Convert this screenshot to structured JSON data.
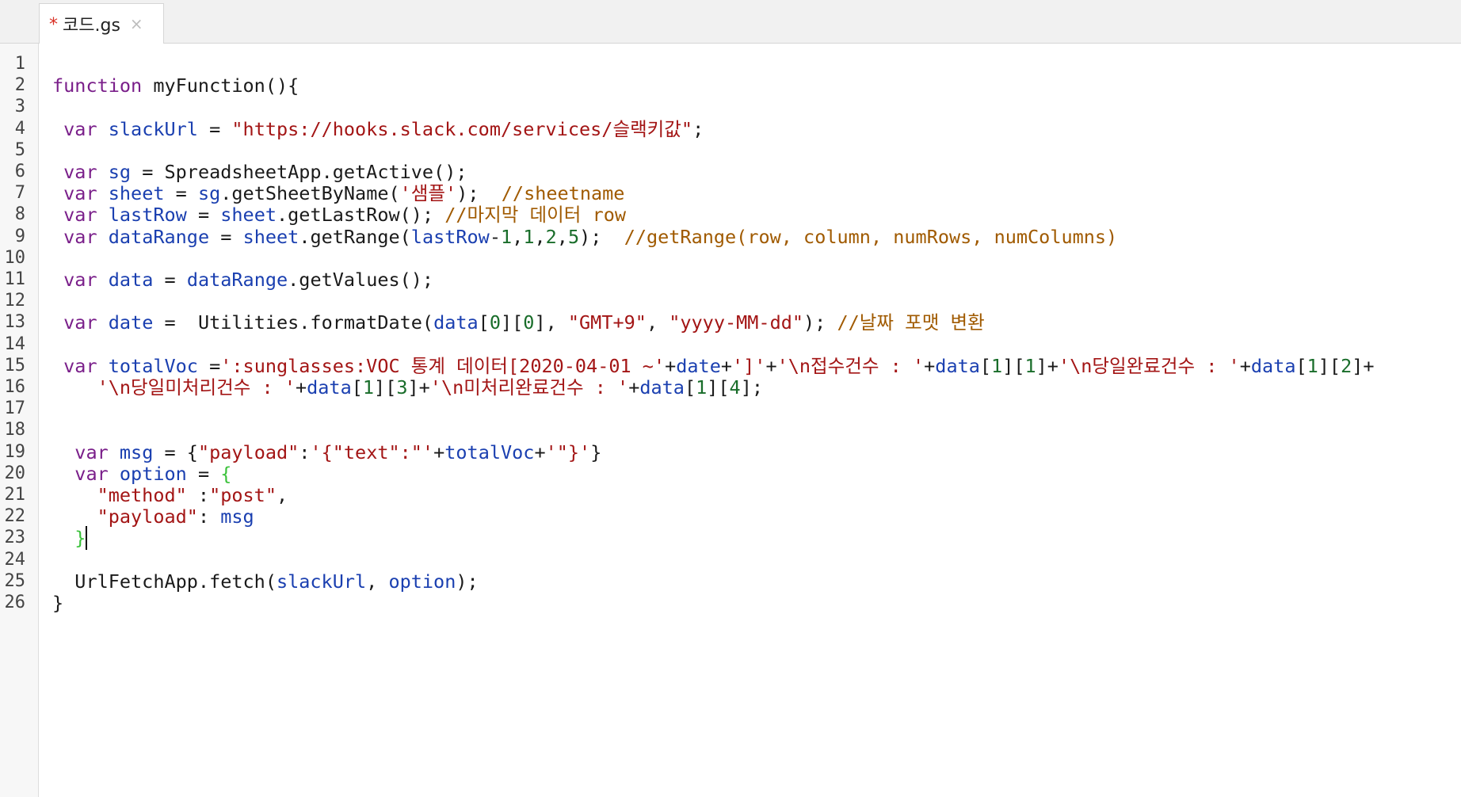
{
  "tab": {
    "modified_marker": "*",
    "filename": "코드.gs",
    "close_glyph": "×"
  },
  "editor": {
    "line_numbers": [
      "1",
      "2",
      "3",
      "4",
      "5",
      "6",
      "7",
      "8",
      "9",
      "10",
      "11",
      "12",
      "13",
      "14",
      "15",
      "16",
      "17",
      "18",
      "19",
      "20",
      "21",
      "22",
      "23",
      "24",
      "25",
      "26"
    ],
    "lines": [
      [],
      [
        [
          "kw",
          "function"
        ],
        [
          "txt",
          " "
        ],
        [
          "def",
          "myFunction"
        ],
        [
          "txt",
          "(){"
        ]
      ],
      [],
      [
        [
          "txt",
          " "
        ],
        [
          "kw",
          "var"
        ],
        [
          "txt",
          " "
        ],
        [
          "var",
          "slackUrl"
        ],
        [
          "txt",
          " = "
        ],
        [
          "str",
          "\"https://hooks.slack.com/services/슬랙키값\""
        ],
        [
          "txt",
          ";"
        ]
      ],
      [],
      [
        [
          "txt",
          " "
        ],
        [
          "kw",
          "var"
        ],
        [
          "txt",
          " "
        ],
        [
          "var",
          "sg"
        ],
        [
          "txt",
          " = SpreadsheetApp.getActive();"
        ]
      ],
      [
        [
          "txt",
          " "
        ],
        [
          "kw",
          "var"
        ],
        [
          "txt",
          " "
        ],
        [
          "var",
          "sheet"
        ],
        [
          "txt",
          " = "
        ],
        [
          "var",
          "sg"
        ],
        [
          "txt",
          ".getSheetByName("
        ],
        [
          "str",
          "'샘플'"
        ],
        [
          "txt",
          ");  "
        ],
        [
          "com",
          "//sheetname"
        ]
      ],
      [
        [
          "txt",
          " "
        ],
        [
          "kw",
          "var"
        ],
        [
          "txt",
          " "
        ],
        [
          "var",
          "lastRow"
        ],
        [
          "txt",
          " = "
        ],
        [
          "var",
          "sheet"
        ],
        [
          "txt",
          ".getLastRow(); "
        ],
        [
          "com",
          "//마지막 데이터 row"
        ]
      ],
      [
        [
          "txt",
          " "
        ],
        [
          "kw",
          "var"
        ],
        [
          "txt",
          " "
        ],
        [
          "var",
          "dataRange"
        ],
        [
          "txt",
          " = "
        ],
        [
          "var",
          "sheet"
        ],
        [
          "txt",
          ".getRange("
        ],
        [
          "var",
          "lastRow"
        ],
        [
          "txt",
          "-"
        ],
        [
          "num",
          "1"
        ],
        [
          "txt",
          ","
        ],
        [
          "num",
          "1"
        ],
        [
          "txt",
          ","
        ],
        [
          "num",
          "2"
        ],
        [
          "txt",
          ","
        ],
        [
          "num",
          "5"
        ],
        [
          "txt",
          ");  "
        ],
        [
          "com",
          "//getRange(row, column, numRows, numColumns)"
        ]
      ],
      [],
      [
        [
          "txt",
          " "
        ],
        [
          "kw",
          "var"
        ],
        [
          "txt",
          " "
        ],
        [
          "var",
          "data"
        ],
        [
          "txt",
          " = "
        ],
        [
          "var",
          "dataRange"
        ],
        [
          "txt",
          ".getValues();"
        ]
      ],
      [],
      [
        [
          "txt",
          " "
        ],
        [
          "kw",
          "var"
        ],
        [
          "txt",
          " "
        ],
        [
          "var",
          "date"
        ],
        [
          "txt",
          " =  Utilities.formatDate("
        ],
        [
          "var",
          "data"
        ],
        [
          "txt",
          "["
        ],
        [
          "num",
          "0"
        ],
        [
          "txt",
          "]["
        ],
        [
          "num",
          "0"
        ],
        [
          "txt",
          "], "
        ],
        [
          "str",
          "\"GMT+9\""
        ],
        [
          "txt",
          ", "
        ],
        [
          "str",
          "\"yyyy-MM-dd\""
        ],
        [
          "txt",
          "); "
        ],
        [
          "com",
          "//날짜 포맷 변환"
        ]
      ],
      [],
      [
        [
          "txt",
          " "
        ],
        [
          "kw",
          "var"
        ],
        [
          "txt",
          " "
        ],
        [
          "var",
          "totalVoc"
        ],
        [
          "txt",
          " ="
        ],
        [
          "str",
          "':sunglasses:VOC 통계 데이터[2020-04-01 ~'"
        ],
        [
          "txt",
          "+"
        ],
        [
          "var",
          "date"
        ],
        [
          "txt",
          "+"
        ],
        [
          "str",
          "']'"
        ],
        [
          "txt",
          "+"
        ],
        [
          "str",
          "'\\n접수건수 : '"
        ],
        [
          "txt",
          "+"
        ],
        [
          "var",
          "data"
        ],
        [
          "txt",
          "["
        ],
        [
          "num",
          "1"
        ],
        [
          "txt",
          "]["
        ],
        [
          "num",
          "1"
        ],
        [
          "txt",
          "]+"
        ],
        [
          "str",
          "'\\n당일완료건수 : '"
        ],
        [
          "txt",
          "+"
        ],
        [
          "var",
          "data"
        ],
        [
          "txt",
          "["
        ],
        [
          "num",
          "1"
        ],
        [
          "txt",
          "]["
        ],
        [
          "num",
          "2"
        ],
        [
          "txt",
          "]+"
        ]
      ],
      [
        [
          "txt",
          "    "
        ],
        [
          "str",
          "'\\n당일미처리건수 : '"
        ],
        [
          "txt",
          "+"
        ],
        [
          "var",
          "data"
        ],
        [
          "txt",
          "["
        ],
        [
          "num",
          "1"
        ],
        [
          "txt",
          "]["
        ],
        [
          "num",
          "3"
        ],
        [
          "txt",
          "]+"
        ],
        [
          "str",
          "'\\n미처리완료건수 : '"
        ],
        [
          "txt",
          "+"
        ],
        [
          "var",
          "data"
        ],
        [
          "txt",
          "["
        ],
        [
          "num",
          "1"
        ],
        [
          "txt",
          "]["
        ],
        [
          "num",
          "4"
        ],
        [
          "txt",
          "];"
        ]
      ],
      [],
      [],
      [
        [
          "txt",
          "  "
        ],
        [
          "kw",
          "var"
        ],
        [
          "txt",
          " "
        ],
        [
          "var",
          "msg"
        ],
        [
          "txt",
          " = {"
        ],
        [
          "str",
          "\"payload\""
        ],
        [
          "txt",
          ":"
        ],
        [
          "str",
          "'{\"text\":\"'"
        ],
        [
          "txt",
          "+"
        ],
        [
          "var",
          "totalVoc"
        ],
        [
          "txt",
          "+"
        ],
        [
          "str",
          "'\"}'"
        ],
        [
          "txt",
          "}"
        ]
      ],
      [
        [
          "txt",
          "  "
        ],
        [
          "kw",
          "var"
        ],
        [
          "txt",
          " "
        ],
        [
          "var",
          "option"
        ],
        [
          "txt",
          " = "
        ],
        [
          "brk",
          "{"
        ]
      ],
      [
        [
          "txt",
          "    "
        ],
        [
          "str",
          "\"method\""
        ],
        [
          "txt",
          " :"
        ],
        [
          "str",
          "\"post\""
        ],
        [
          "txt",
          ","
        ]
      ],
      [
        [
          "txt",
          "    "
        ],
        [
          "str",
          "\"payload\""
        ],
        [
          "txt",
          ": "
        ],
        [
          "var",
          "msg"
        ]
      ],
      [
        [
          "txt",
          "  "
        ],
        [
          "brk",
          "}"
        ],
        [
          "caret",
          ""
        ]
      ],
      [],
      [
        [
          "txt",
          "  UrlFetchApp.fetch("
        ],
        [
          "var",
          "slackUrl"
        ],
        [
          "txt",
          ", "
        ],
        [
          "var",
          "option"
        ],
        [
          "txt",
          ");"
        ]
      ],
      [
        [
          "txt",
          "}"
        ]
      ]
    ]
  },
  "colors": {
    "keyword": "#7a1f8a",
    "variable": "#1a3fb0",
    "string": "#a31515",
    "number": "#196d2a",
    "comment": "#a05a00",
    "matched_bracket": "#3ac13a",
    "modified_marker": "#d93025"
  }
}
